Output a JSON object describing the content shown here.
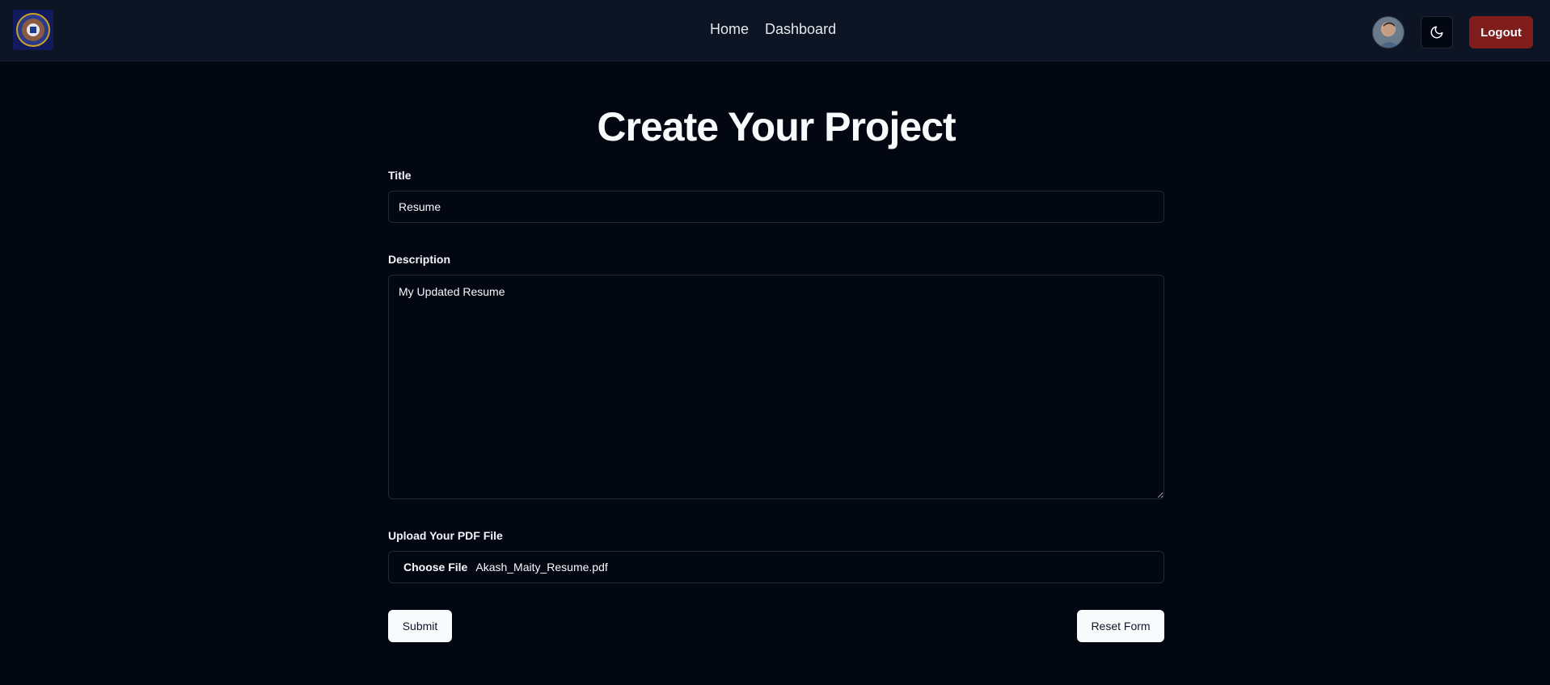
{
  "nav": {
    "links": [
      "Home",
      "Dashboard"
    ],
    "logout_label": "Logout"
  },
  "icons": {
    "logo": "emblem-logo",
    "avatar": "user-avatar",
    "theme": "moon-icon"
  },
  "colors": {
    "background": "#030712",
    "navbar": "#0d1424",
    "logout": "#7f1d1d",
    "light_button": "#f8fafc"
  },
  "page": {
    "title": "Create Your Project"
  },
  "form": {
    "title_label": "Title",
    "title_value": "Resume",
    "description_label": "Description",
    "description_value": "My Updated Resume",
    "upload_label": "Upload Your PDF File",
    "choose_file_label": "Choose File",
    "file_name": "Akash_Maity_Resume.pdf",
    "submit_label": "Submit",
    "reset_label": "Reset Form"
  }
}
